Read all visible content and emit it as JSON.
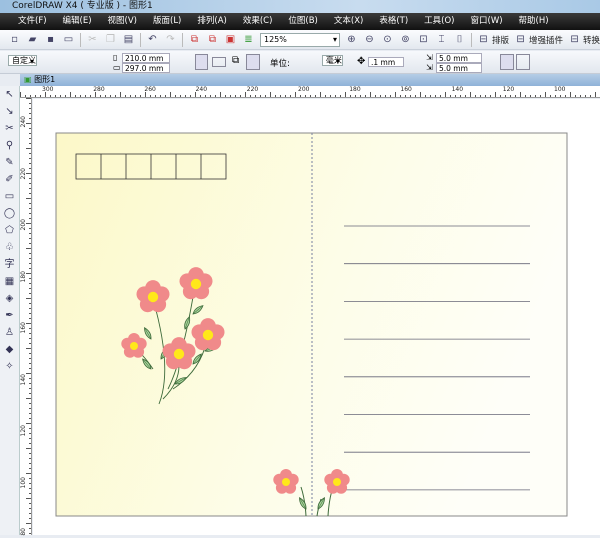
{
  "window": {
    "title": "CorelDRAW X4 ( 专业版 ) - 图形1"
  },
  "menu": [
    "文件(F)",
    "编辑(E)",
    "视图(V)",
    "版面(L)",
    "排列(A)",
    "效果(C)",
    "位图(B)",
    "文本(X)",
    "表格(T)",
    "工具(O)",
    "窗口(W)",
    "帮助(H)"
  ],
  "toolbar": {
    "zoom": "125%",
    "buttons": [
      "排版",
      "增强插件",
      "转换"
    ]
  },
  "property_bar": {
    "paper_preset": "自定义",
    "width": "210.0 mm",
    "height": "297.0 mm",
    "units_label": "单位:",
    "units": "毫米",
    "nudge": ".1 mm",
    "dup_x": "5.0 mm",
    "dup_y": "5.0 mm"
  },
  "document_tab": "图形1",
  "rulers": {
    "horizontal": [
      "300",
      "280",
      "260",
      "240",
      "220",
      "200",
      "180",
      "160",
      "140",
      "120",
      "100"
    ],
    "vertical": [
      "240",
      "220",
      "200",
      "180",
      "160",
      "140",
      "120",
      "100",
      "80"
    ],
    "unit_label": "毫米"
  },
  "colors": {
    "page_bg": "#fdfbd8",
    "petal": "#f08a8a",
    "center": "#ffe81a",
    "leaf": "#a8d49a",
    "line": "#666677"
  }
}
